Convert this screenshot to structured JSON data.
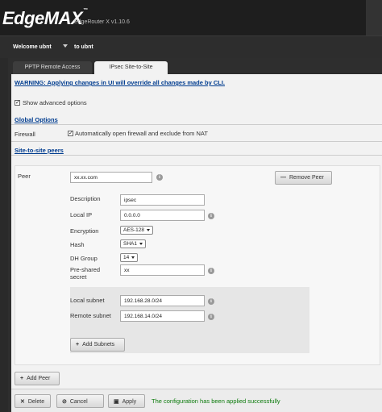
{
  "header": {
    "brand": "EdgeMAX",
    "model": "EdgeRouter X v1.10.6"
  },
  "userbar": {
    "welcome": "Welcome ubnt",
    "to_label": "to ubnt"
  },
  "tabs": [
    {
      "label": "PPTP Remote Access",
      "active": false
    },
    {
      "label": "IPsec Site-to-Site",
      "active": true
    }
  ],
  "warning": "WARNING: Applying changes in UI will override all changes made by CLI.",
  "show_advanced": {
    "label": "Show advanced options",
    "checked": true
  },
  "global_options": {
    "title": "Global Options",
    "firewall_label": "Firewall",
    "firewall_option": "Automatically open firewall and exclude from NAT",
    "firewall_checked": true
  },
  "peers_section": {
    "title": "Site-to-site peers"
  },
  "peer": {
    "peer_label": "Peer",
    "peer_value": "xx.xx.com",
    "remove_button": "Remove Peer",
    "description_label": "Description",
    "description_value": "ipsec",
    "local_ip_label": "Local IP",
    "local_ip_value": "0.0.0.0",
    "encryption_label": "Encryption",
    "encryption_value": "AES-128",
    "hash_label": "Hash",
    "hash_value": "SHA1",
    "dh_group_label": "DH Group",
    "dh_group_value": "14",
    "psk_label_1": "Pre-shared",
    "psk_label_2": "secret",
    "psk_value": "xx",
    "local_subnet_label": "Local subnet",
    "local_subnet_value": "192.168.28.0/24",
    "remote_subnet_label": "Remote subnet",
    "remote_subnet_value": "192.168.14.0/24",
    "add_subnets_button": "Add Subnets"
  },
  "add_peer_button": "Add Peer",
  "footer": {
    "delete_button": "Delete",
    "cancel_button": "Cancel",
    "apply_button": "Apply",
    "status_message": "The configuration has been applied successfully"
  },
  "colors": {
    "section_link": "#003c8f",
    "success": "#0a7a0a",
    "header_bg": "#1e1e1e"
  }
}
